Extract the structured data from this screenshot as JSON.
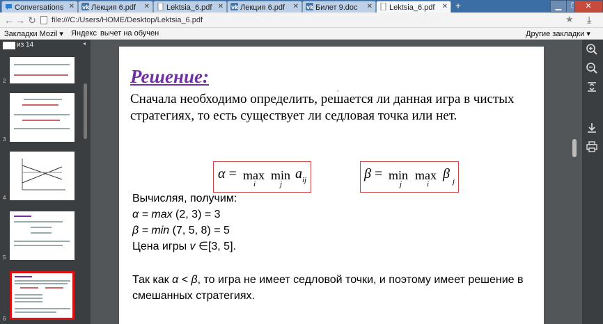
{
  "tabs": [
    {
      "label": "Conversations",
      "icon": "chat-icon",
      "active": false
    },
    {
      "label": "Лекция 6.pdf",
      "icon": "vk-icon",
      "active": false
    },
    {
      "label": "Lektsia_6.pdf",
      "icon": "page-icon",
      "active": false
    },
    {
      "label": "Лекция 6.pdf",
      "icon": "vk-icon",
      "active": false
    },
    {
      "label": "Билет 9.doc",
      "icon": "vk-icon",
      "active": false
    },
    {
      "label": "Lektsia_6.pdf",
      "icon": "page-icon",
      "active": true
    }
  ],
  "toolbar": {
    "url": "file:///C:/Users/HOME/Desktop/Lektsia_6.pdf"
  },
  "bookmarks": {
    "items": [
      "Закладки Mozil",
      "Яндекс",
      "вычет на обучен"
    ],
    "other": "Другие закладки"
  },
  "viewer": {
    "page_count": "из 14",
    "thumb_numbers": [
      "2",
      "3",
      "4",
      "5",
      "6"
    ]
  },
  "slide": {
    "heading": "Решение:",
    "paragraph": "Сначала необходимо определить, решается ли данная игра в чистых стратегиях, то есть существует ли седловая точка или нет.",
    "formula1": {
      "lhs": "α",
      "eq": "=",
      "op1": "max",
      "op2": "min",
      "var": "a",
      "varsub": "ij",
      "sub1": "i",
      "sub2": "j"
    },
    "formula2": {
      "lhs": "β",
      "eq": "=",
      "op1": "min",
      "op2": "max",
      "var": "β",
      "varsub": "j",
      "sub1": "j",
      "sub2": "i"
    },
    "calc_intro": "Вычисляя, получим:",
    "alpha_sym": "α",
    "alpha_expr": "= max",
    "alpha_rest": "(2, 3) = 3",
    "beta_sym": "β",
    "beta_expr": "= min",
    "beta_rest": "(7, 5, 8) = 5",
    "price_text": "Цена игры",
    "price_var": "v",
    "price_set": "∈[3, 5].",
    "conclusion_pre": "Так как",
    "conclusion_cond": "α < β",
    "conclusion_post": ", то игра не имеет седловой точки, и поэтому имеет решение в смешанных стратегиях."
  }
}
